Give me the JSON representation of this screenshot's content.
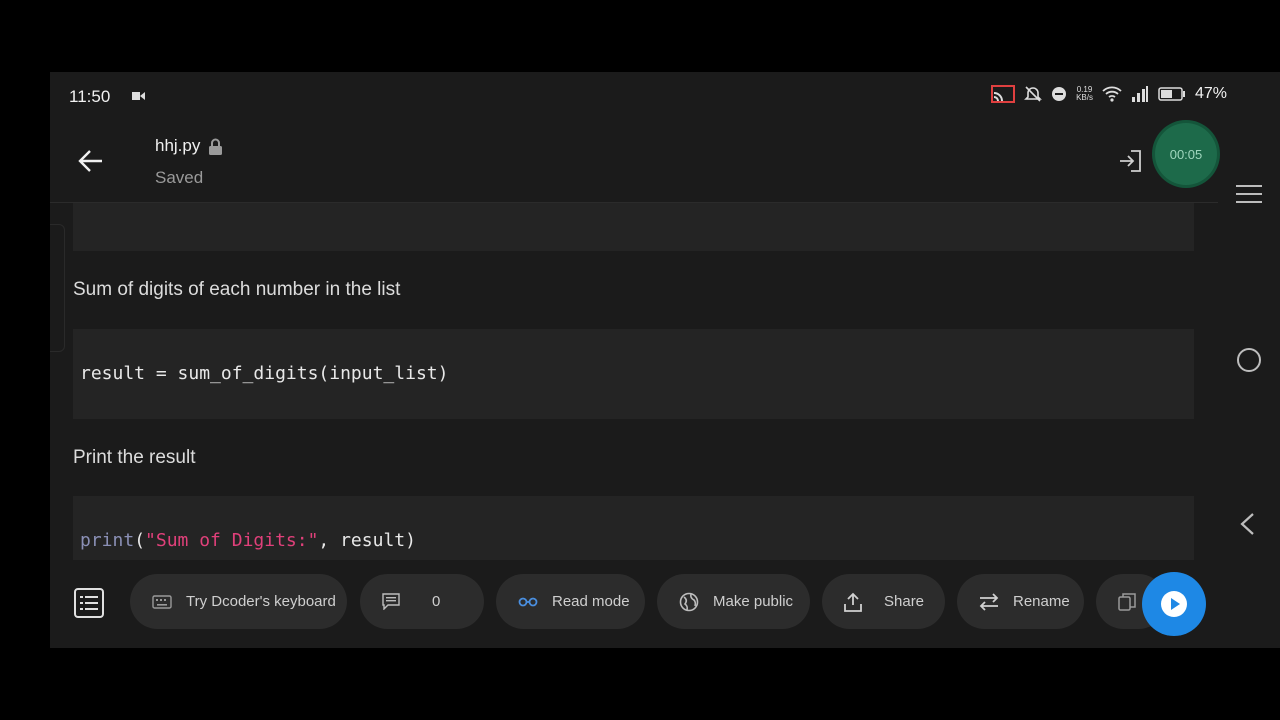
{
  "status_bar": {
    "time": "11:50",
    "net_speed_value": "0.19",
    "net_speed_unit": "KB/s",
    "battery": "47%"
  },
  "header": {
    "filename": "hhj.py",
    "save_status": "Saved",
    "timer": "00:05"
  },
  "content": {
    "blocks": [
      {
        "type": "text",
        "text": "Sum of digits of each number in the list"
      },
      {
        "type": "code",
        "text": "result = sum_of_digits(input_list)"
      },
      {
        "type": "text",
        "text": "Print the result"
      },
      {
        "type": "code",
        "tokens": {
          "fn": "print",
          "open": "(",
          "str": "\"Sum of Digits:\"",
          "rest": ", result)"
        }
      }
    ]
  },
  "toolbar": {
    "keyboard_label": "Try Dcoder's keyboard",
    "comments_count": "0",
    "read_mode_label": "Read mode",
    "make_public_label": "Make public",
    "share_label": "Share",
    "rename_label": "Rename"
  },
  "icons": {
    "back": "arrow-left-icon",
    "lock": "lock-icon",
    "exit": "exit-icon",
    "menu": "menu-icon",
    "list": "list-icon",
    "keyboard": "keyboard-icon",
    "comment": "comment-icon",
    "read_mode": "glasses-icon",
    "globe": "globe-icon",
    "share": "share-icon",
    "rename": "swap-icon",
    "run": "play-icon"
  },
  "colors": {
    "run_button": "#1e88e5",
    "timer": "#1d6a4a",
    "string_literal": "#e0407a",
    "function_name": "#8a8fb5",
    "read_mode_icon": "#4a8fe0"
  }
}
